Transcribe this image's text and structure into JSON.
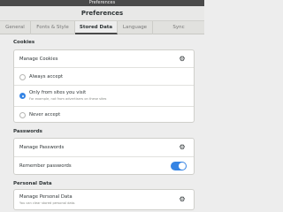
{
  "window": {
    "title": "Preferences"
  },
  "header": {
    "title": "Preferences"
  },
  "tabs": [
    {
      "label": "General",
      "active": false
    },
    {
      "label": "Fonts & Style",
      "active": false
    },
    {
      "label": "Stored Data",
      "active": true
    },
    {
      "label": "Language",
      "active": false
    },
    {
      "label": "Sync",
      "active": false
    }
  ],
  "cookies": {
    "section_title": "Cookies",
    "manage_label": "Manage Cookies",
    "options": [
      {
        "label": "Always accept",
        "sub": "",
        "checked": false
      },
      {
        "label": "Only from sites you visit",
        "sub": "For example, not from advertisers on these sites",
        "checked": true
      },
      {
        "label": "Never accept",
        "sub": "",
        "checked": false
      }
    ]
  },
  "passwords": {
    "section_title": "Passwords",
    "manage_label": "Manage Passwords",
    "remember_label": "Remember passwords",
    "remember_on": true
  },
  "personal_data": {
    "section_title": "Personal Data",
    "manage_label": "Manage Personal Data",
    "manage_sub": "You can clear stored personal data."
  },
  "icons": {
    "settings": "gear-icon"
  },
  "colors": {
    "accent": "#3584e4"
  }
}
